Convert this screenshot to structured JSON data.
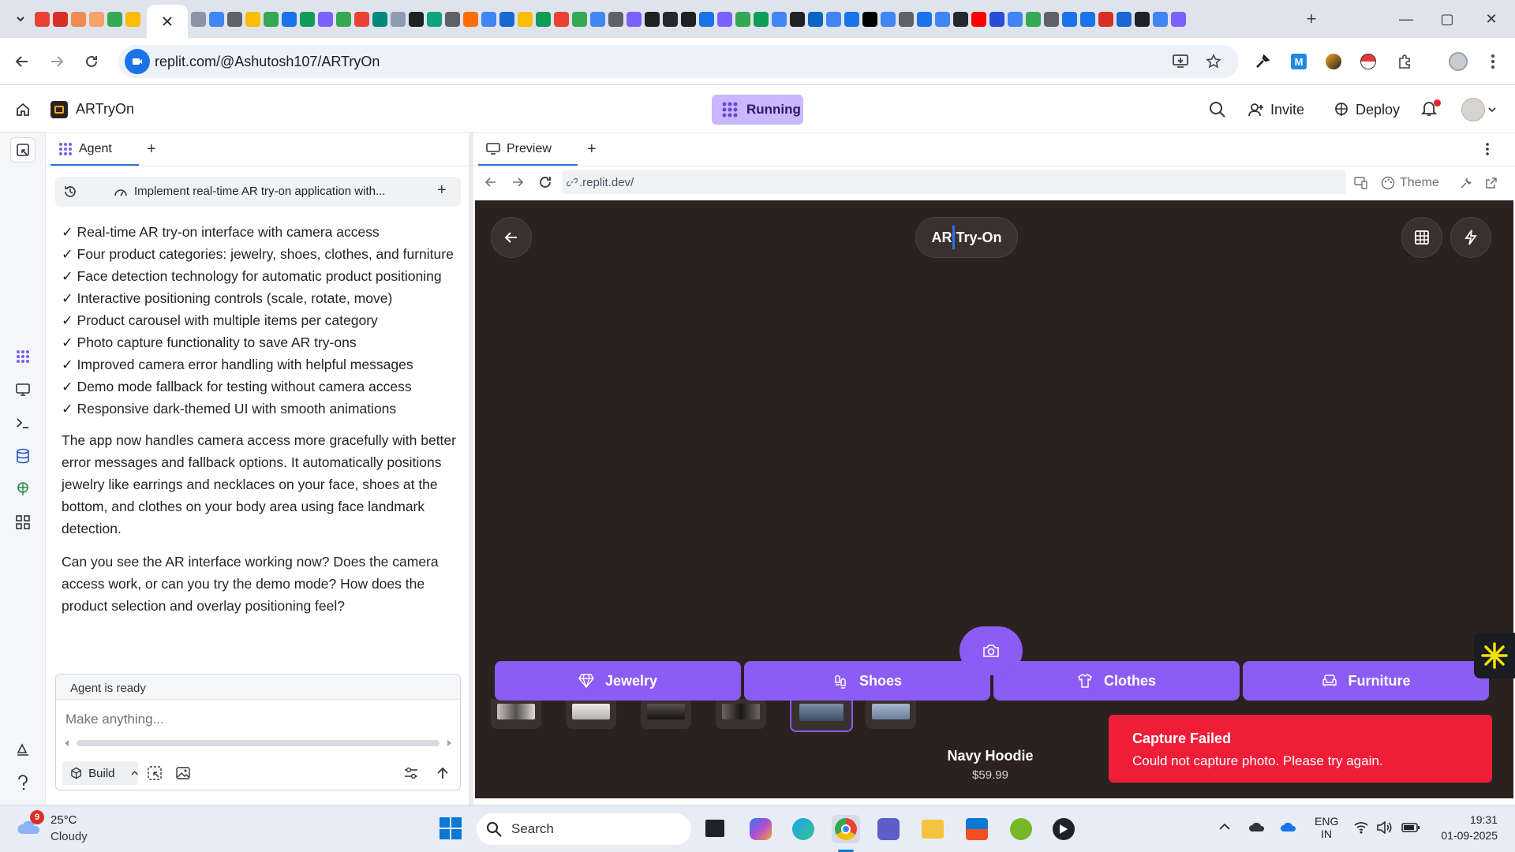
{
  "browser": {
    "address": "replit.com/@Ashutosh107/ARTryOn",
    "window_controls": {
      "minimize": "—",
      "maximize": "▢",
      "close": "✕"
    }
  },
  "replit": {
    "project_name": "ARTryOn",
    "status": "Running",
    "header": {
      "invite": "Invite",
      "deploy": "Deploy"
    }
  },
  "agent": {
    "tab_label": "Agent",
    "task_title": "Implement real-time AR try-on application with...",
    "features": [
      "✓ Real-time AR try-on interface with camera access",
      "✓ Four product categories: jewelry, shoes, clothes, and furniture",
      "✓ Face detection technology for automatic product positioning",
      "✓ Interactive positioning controls (scale, rotate, move)",
      "✓ Product carousel with multiple items per category",
      "✓ Photo capture functionality to save AR try-ons",
      "✓ Improved camera error handling with helpful messages",
      "✓ Demo mode fallback for testing without camera access",
      "✓ Responsive dark-themed UI with smooth animations"
    ],
    "paragraph_1": "The app now handles camera access more gracefully with better error messages and fallback options. It automatically positions jewelry like earrings and necklaces on your face, shoes at the bottom, and clothes on your body area using face landmark detection.",
    "paragraph_2": "Can you see the AR interface working now? Does the camera access work, or can you try the demo mode? How does the product selection and overlay positioning feel?",
    "composer_status": "Agent is ready",
    "composer_placeholder": "Make anything...",
    "build_label": "Build"
  },
  "preview": {
    "tab_label": "Preview",
    "url": ".replit.dev/",
    "theme_label": "Theme"
  },
  "app": {
    "title": "AR Try-On",
    "categories": [
      "Jewelry",
      "Shoes",
      "Clothes",
      "Furniture"
    ],
    "selected_product": {
      "name": "Navy Hoodie",
      "price": "$59.99"
    },
    "toast": {
      "title": "Capture Failed",
      "description": "Could not capture photo. Please try again."
    },
    "colors": {
      "accent": "#8b5cf6",
      "app_bg": "#2b2220",
      "toast_bg": "#ef1d37"
    }
  },
  "taskbar": {
    "weather_temp": "25°C",
    "weather_desc": "Cloudy",
    "weather_badge": "9",
    "search_label": "Search",
    "lang_1": "ENG",
    "lang_2": "IN",
    "time": "19:31",
    "date": "01-09-2025"
  }
}
